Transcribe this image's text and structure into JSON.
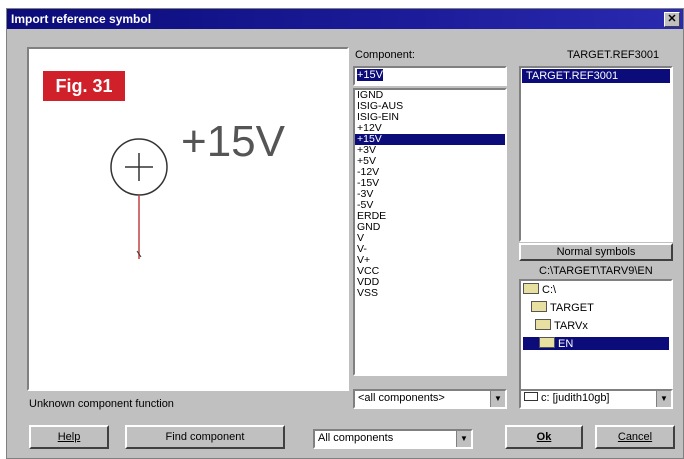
{
  "window": {
    "title": "Import reference symbol",
    "close_label": "✕"
  },
  "preview": {
    "fig_label": "Fig. 31",
    "symbol_name": "+15V",
    "status": "Unknown component function"
  },
  "component": {
    "label": "Component:",
    "library_title": "TARGET.REF3001",
    "input_value": "+15V",
    "items": [
      "IGND",
      "ISIG-AUS",
      "ISIG-EIN",
      "+12V",
      "+15V",
      "+3V",
      "+5V",
      "-12V",
      "-15V",
      "-3V",
      "-5V",
      "ERDE",
      "GND",
      "V",
      "V-",
      "V+",
      "VCC",
      "VDD",
      "VSS"
    ],
    "selected": "+15V",
    "filter_value": "<all components>"
  },
  "library": {
    "items": [
      "TARGET.REF3001"
    ],
    "normal_symbols_label": "Normal symbols",
    "path": "C:\\TARGET\\TARV9\\EN",
    "dirs": [
      "C:\\",
      "TARGET",
      "TARVx",
      "EN"
    ],
    "drive_value": "c: [judith10gb]"
  },
  "footer": {
    "help_label": "Help",
    "find_label": "Find component",
    "filter_value": "All components",
    "ok_label": "Ok",
    "cancel_label": "Cancel"
  }
}
